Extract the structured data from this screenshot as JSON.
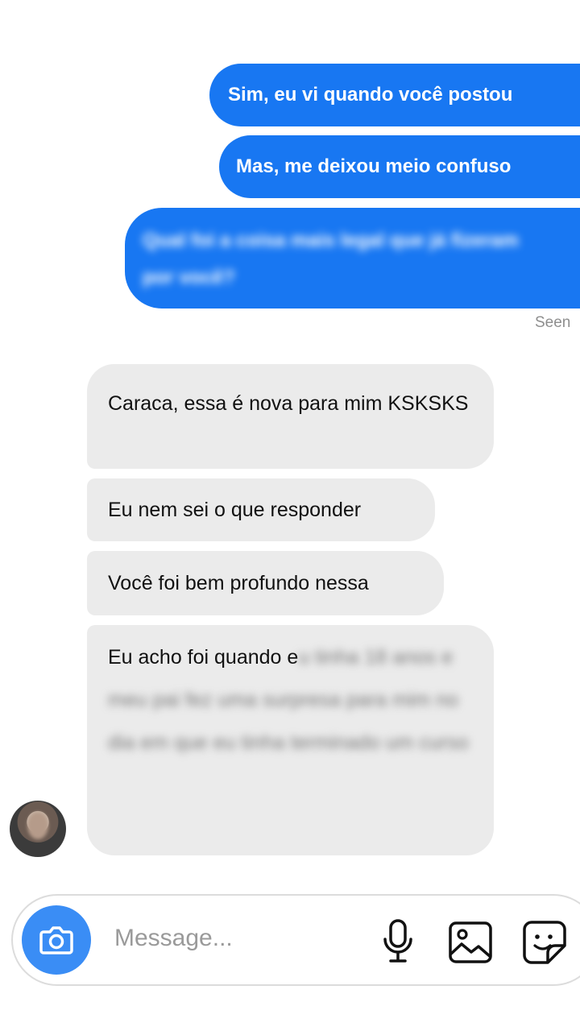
{
  "outgoing": [
    {
      "text": "Sim, eu vi quando você postou"
    },
    {
      "text": "Mas, me deixou meio confuso"
    },
    {
      "text": "Qual foi a coisa mais legal que já fizeram por você?",
      "blurred": true
    }
  ],
  "seen_label": "Seen",
  "incoming": [
    {
      "text": "Caraca, essa é nova para mim KSKSKS"
    },
    {
      "text": "Eu nem sei o que responder"
    },
    {
      "text": "Você foi bem profundo nessa"
    },
    {
      "text_visible": "Eu acho foi quando e",
      "text_blurred": "u tinha 18 anos e meu pai fez uma surpresa para mim no dia em que eu tinha terminado um curso"
    }
  ],
  "composer": {
    "placeholder": "Message...",
    "icons": [
      "camera-icon",
      "microphone-icon",
      "gallery-icon",
      "sticker-icon"
    ]
  },
  "colors": {
    "outgoing_bubble": "#1877f2",
    "incoming_bubble": "#ebebeb",
    "camera_button": "#3a8df5"
  }
}
